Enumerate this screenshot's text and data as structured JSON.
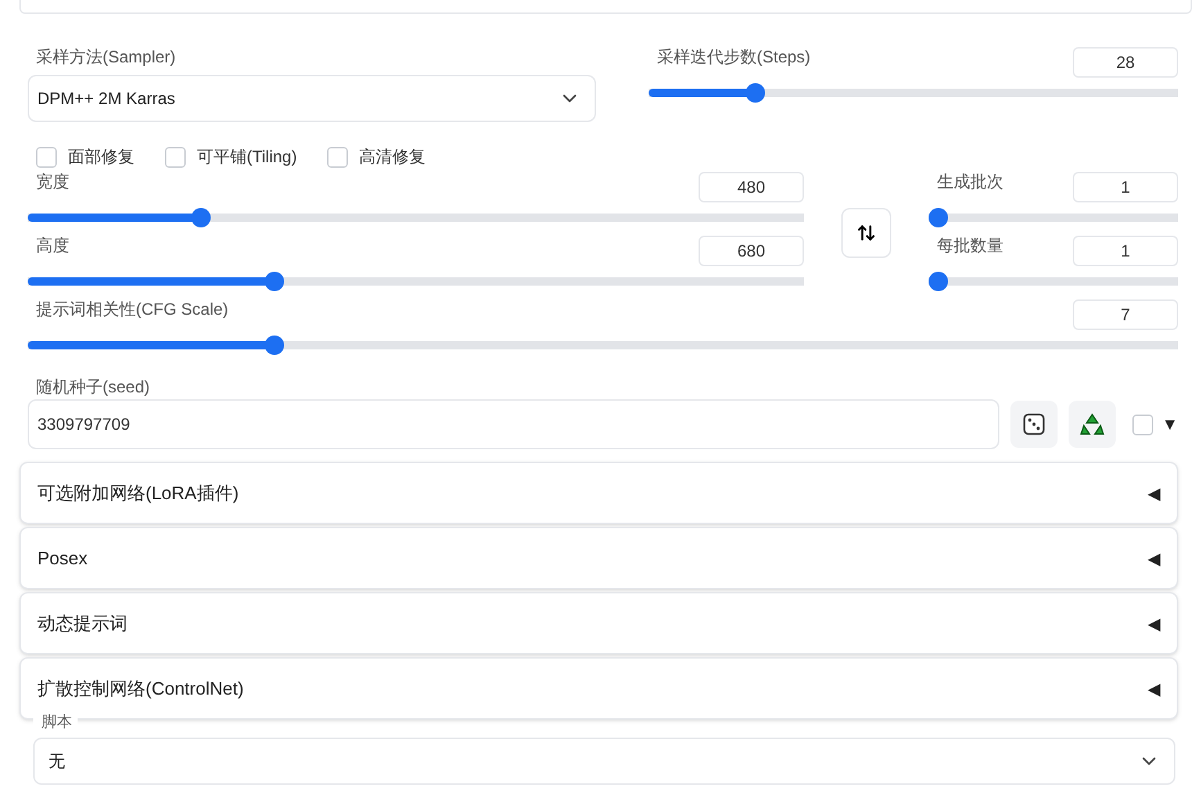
{
  "sampler": {
    "label": "采样方法(Sampler)",
    "value": "DPM++ 2M Karras"
  },
  "steps": {
    "label": "采样迭代步数(Steps)",
    "value": "28",
    "level": 0.19
  },
  "options": [
    {
      "label": "面部修复",
      "checked": false
    },
    {
      "label": "可平铺(Tiling)",
      "checked": false
    },
    {
      "label": "高清修复",
      "checked": false
    }
  ],
  "size_sliders": [
    {
      "label": "宽度",
      "value": "480",
      "level": 0.217
    },
    {
      "label": "高度",
      "value": "680",
      "level": 0.314
    }
  ],
  "batch_sliders": [
    {
      "label": "生成批次",
      "value": "1",
      "level": 0
    },
    {
      "label": "每批数量",
      "value": "1",
      "level": 0
    }
  ],
  "cfg": {
    "label": "提示词相关性(CFG Scale)",
    "value": "7",
    "level": 0.21
  },
  "seed": {
    "label": "随机种子(seed)",
    "value": "3309797709",
    "extra_checked": false,
    "extra_arrow": "▼"
  },
  "accordions": [
    {
      "title": "可选附加网络(LoRA插件)",
      "arrow": "◀"
    },
    {
      "title": "Posex",
      "arrow": "◀"
    },
    {
      "title": "动态提示词",
      "arrow": "◀"
    },
    {
      "title": "扩散控制网络(ControlNet)",
      "arrow": "◀"
    }
  ],
  "script": {
    "label": "脚本",
    "value": "无"
  }
}
